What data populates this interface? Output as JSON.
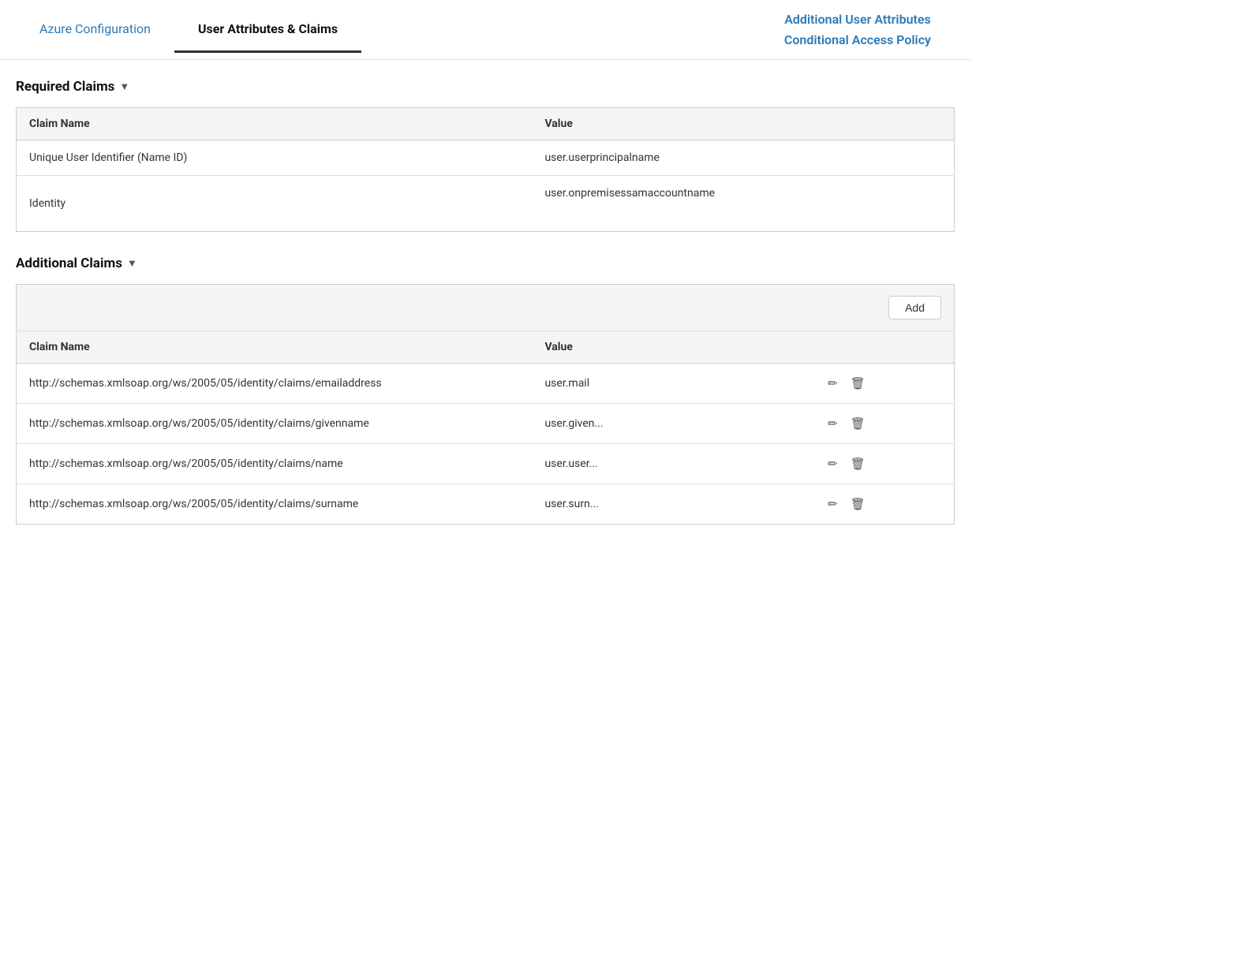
{
  "nav": {
    "tabs": [
      {
        "id": "azure-config",
        "label": "Azure Configuration",
        "active": false
      },
      {
        "id": "user-attributes",
        "label": "User Attributes & Claims",
        "active": true
      }
    ],
    "right_links": [
      {
        "id": "additional-user-attributes",
        "label": "Additional User Attributes"
      },
      {
        "id": "conditional-access-policy",
        "label": "Conditional Access Policy"
      }
    ]
  },
  "required_claims": {
    "section_label": "Required Claims",
    "col_name": "Claim Name",
    "col_value": "Value",
    "rows": [
      {
        "name": "Unique User Identifier (Name ID)",
        "value": "user.userprincipalname"
      },
      {
        "name": "Identity",
        "value": "user.onpremisessamaccountname"
      }
    ]
  },
  "additional_claims": {
    "section_label": "Additional Claims",
    "add_button_label": "Add",
    "col_name": "Claim Name",
    "col_value": "Value",
    "rows": [
      {
        "name": "http://schemas.xmlsoap.org/ws/2005/05/identity/claims/emailaddress",
        "value": "user.mail"
      },
      {
        "name": "http://schemas.xmlsoap.org/ws/2005/05/identity/claims/givenname",
        "value": "user.given..."
      },
      {
        "name": "http://schemas.xmlsoap.org/ws/2005/05/identity/claims/name",
        "value": "user.user..."
      },
      {
        "name": "http://schemas.xmlsoap.org/ws/2005/05/identity/claims/surname",
        "value": "user.surn..."
      }
    ]
  },
  "icons": {
    "chevron_down": "▼",
    "edit": "✏",
    "delete": "🗑"
  }
}
